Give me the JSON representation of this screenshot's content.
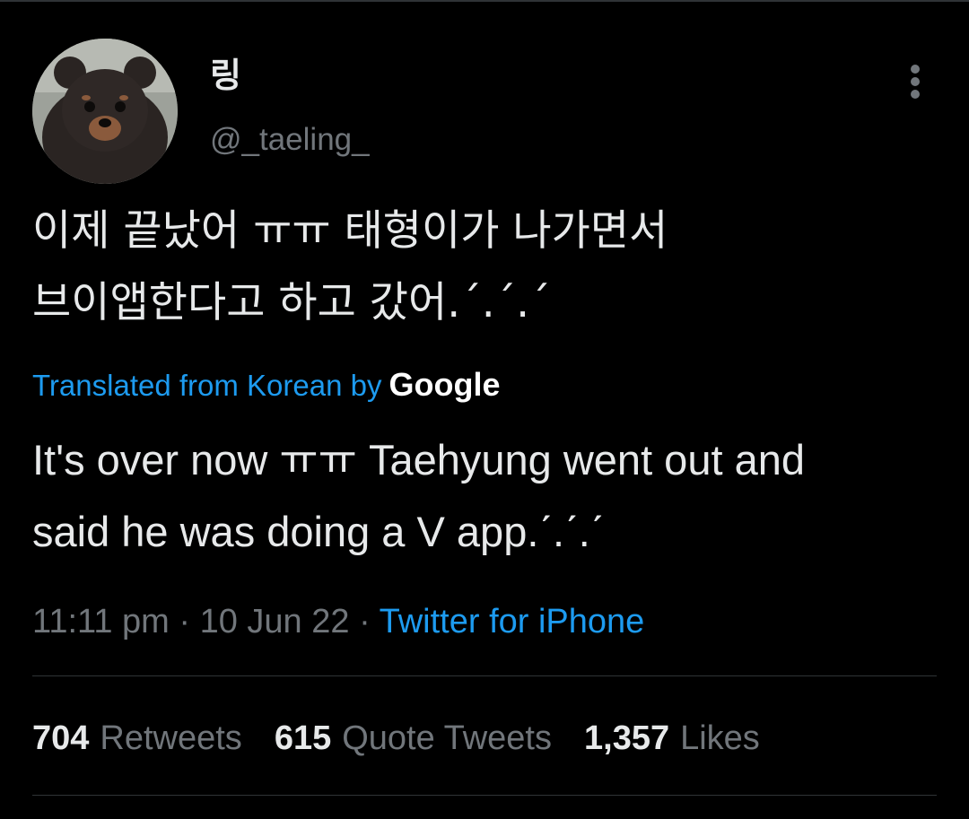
{
  "author": {
    "display_name": "링",
    "handle": "@_taeling_",
    "avatar_icon": "bear-puppy-avatar"
  },
  "tweet": {
    "text_line_1": "이제 끝났어 ㅠㅠ 태형이가 나가면서",
    "text_line_2": "브이앱한다고 하고 갔어.ˊ.ˊ.ˊ",
    "translated_label": "Translated from Korean by",
    "translation_provider": "Google",
    "translation_line_1": "It's over now ㅠㅠ Taehyung went out and",
    "translation_line_2": "said he was doing a V app.ˊ.ˊ.ˊ"
  },
  "meta": {
    "time": "11:11 pm",
    "separator_1": " · ",
    "date": "10 Jun 22",
    "separator_2": " · ",
    "source": "Twitter for iPhone"
  },
  "stats": {
    "retweets_count": "704",
    "retweets_label": "Retweets",
    "quotes_count": "615",
    "quotes_label": "Quote Tweets",
    "likes_count": "1,357",
    "likes_label": "Likes"
  },
  "colors": {
    "background": "#000000",
    "text_primary": "#e7e9ea",
    "text_secondary": "#71767b",
    "accent": "#1d9bf0",
    "divider": "#2f3336"
  }
}
